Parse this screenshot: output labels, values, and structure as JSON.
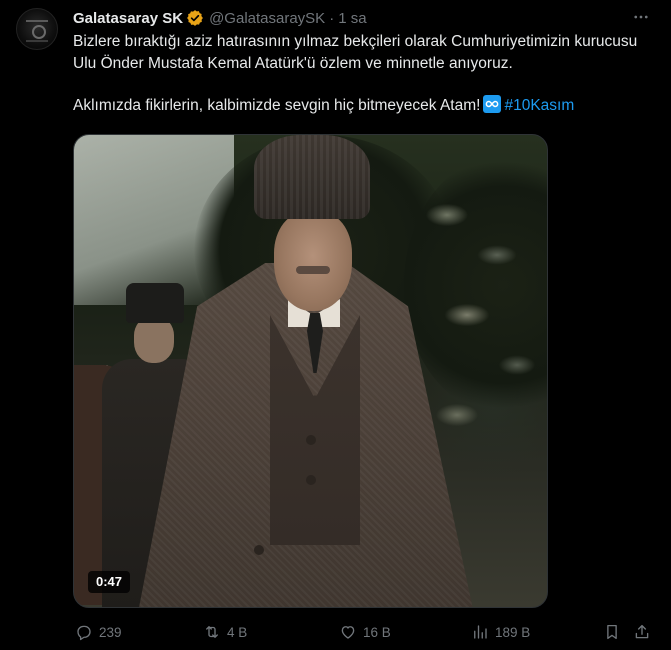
{
  "account": {
    "display_name": "Galatasaray SK",
    "handle": "@GalatasaraySK",
    "separator": "·",
    "time": "1 sa",
    "verified_color": "#e8a317"
  },
  "tweet": {
    "paragraph_1": "Bizlere bıraktığı aziz hatırasının yılmaz bekçileri olarak Cumhuriyetimizin kurucusu Ulu Önder Mustafa Kemal Atatürk'ü özlem ve minnetle anıyoruz.",
    "paragraph_2_text": "Aklımızda fikirlerin, kalbimizde sevgin hiç bitmeyecek Atam!",
    "paragraph_2_emoji": "infinity-icon",
    "hashtag": "#10Kasım"
  },
  "media": {
    "type": "video",
    "duration": "0:47"
  },
  "actions": {
    "replies": "239",
    "reposts": "4 B",
    "likes": "16 B",
    "views": "189 B"
  },
  "colors": {
    "background": "#000000",
    "text": "#e7e9ea",
    "secondary": "#71767b",
    "link": "#1d9bf0"
  }
}
